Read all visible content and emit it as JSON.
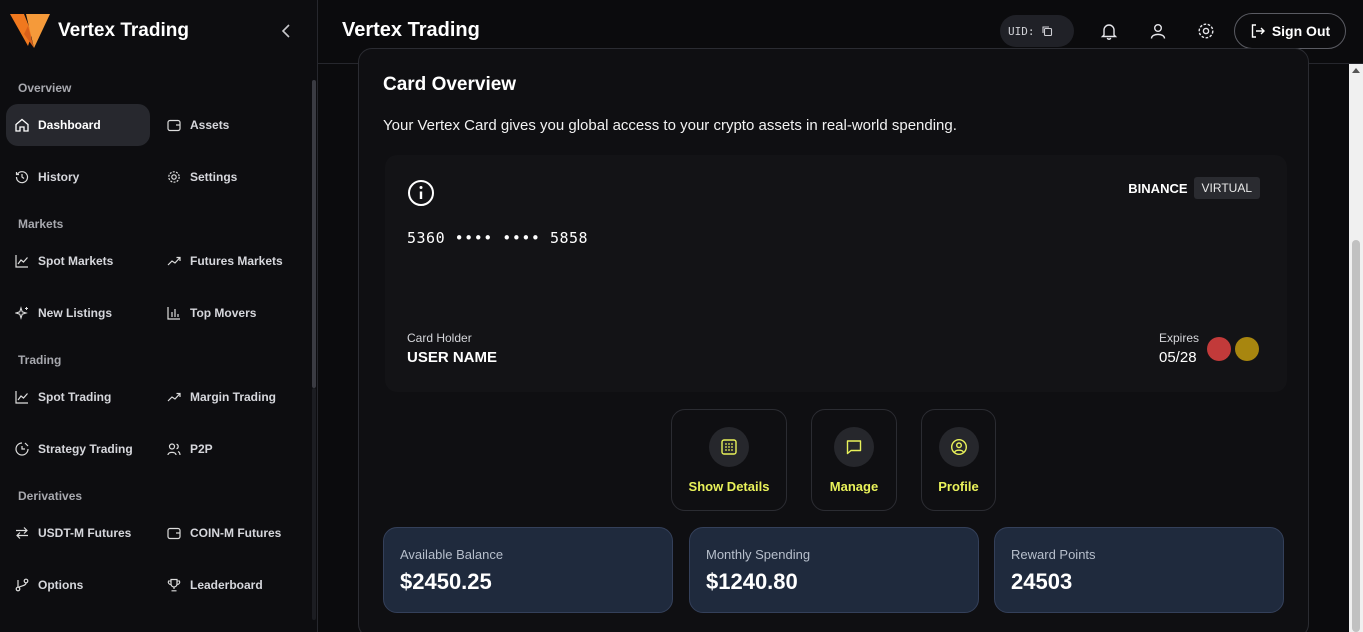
{
  "sidebar": {
    "brand": "Vertex Trading",
    "sections": {
      "overview": "Overview",
      "markets": "Markets",
      "trading": "Trading",
      "derivatives": "Derivatives"
    },
    "items": {
      "dashboard": "Dashboard",
      "assets": "Assets",
      "history": "History",
      "settings": "Settings",
      "spot_markets": "Spot Markets",
      "futures_markets": "Futures Markets",
      "new_listings": "New Listings",
      "top_movers": "Top Movers",
      "spot_trading": "Spot Trading",
      "margin_trading": "Margin Trading",
      "strategy_trading": "Strategy Trading",
      "p2p": "P2P",
      "usdt_m_futures": "USDT-M Futures",
      "coin_m_futures": "COIN-M Futures",
      "options": "Options",
      "leaderboard": "Leaderboard"
    },
    "active": "Dashboard"
  },
  "header": {
    "title": "Vertex Trading",
    "uid_label": "UID:",
    "sign_out": "Sign Out"
  },
  "main": {
    "title": "Card Overview",
    "description": "Your Vertex Card gives you global access to your crypto assets in real-world spending.",
    "card": {
      "network": "BINANCE",
      "type_tag": "VIRTUAL",
      "number": "5360 •••• •••• 5858",
      "holder_label": "Card Holder",
      "holder": "USER NAME",
      "expires_label": "Expires",
      "expires": "05/28",
      "circle_colors": [
        "#c23a3a",
        "#a8860f"
      ]
    },
    "actions": {
      "show_details": "Show Details",
      "manage": "Manage",
      "profile": "Profile"
    },
    "stats": {
      "available_label": "Available Balance",
      "available_value": "$2450.25",
      "monthly_label": "Monthly Spending",
      "monthly_value": "$1240.80",
      "reward_label": "Reward Points",
      "reward_value": "24503"
    }
  },
  "colors": {
    "accent": "#e9f25a",
    "brand_orange": "#f0781e",
    "stat_bg": "#1f2a3d"
  }
}
